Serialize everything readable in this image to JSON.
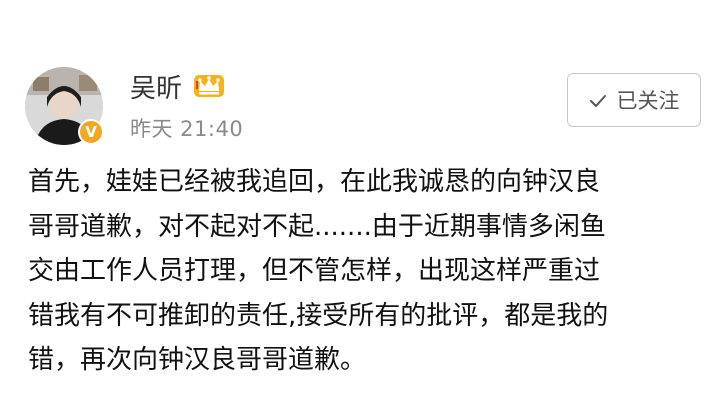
{
  "user": {
    "name": "吴昕",
    "avatar_icon": "avatar-photo",
    "verified_icon": "verified-badge-icon",
    "vip_icon": "crown-icon",
    "verified_color": "#f5a623"
  },
  "meta": {
    "time": "昨天 21:40"
  },
  "follow_button": {
    "label": "已关注",
    "icon": "check-icon"
  },
  "post": {
    "lines": [
      "首先，娃娃已经被我追回，在此我诚恳的向钟汉良",
      "哥哥道歉，对不起对不起.......由于近期事情多闲鱼",
      "交由工作人员打理，但不管怎样，出现这样严重过",
      "错我有不可推卸的责任,接受所有的批评，都是我的",
      "错，再次向钟汉良哥哥道歉。"
    ]
  }
}
